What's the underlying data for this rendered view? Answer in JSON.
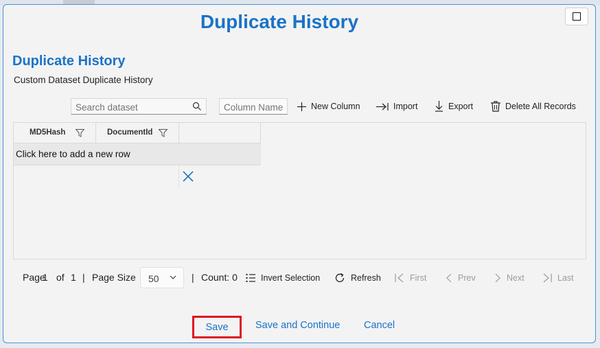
{
  "dialog": {
    "title": "Duplicate History"
  },
  "section": {
    "title": "Duplicate History",
    "subtitle": "Custom Dataset Duplicate History"
  },
  "toolbar": {
    "search_placeholder": "Search dataset",
    "column_name_placeholder": "Column Name",
    "new_column": "New Column",
    "import": "Import",
    "export": "Export",
    "delete_all": "Delete All Records"
  },
  "grid": {
    "columns": [
      "MD5Hash",
      "DocumentId"
    ],
    "add_row_text": "Click here to add a new row"
  },
  "pager": {
    "page_label": "Page",
    "page": "1",
    "of_label": "of",
    "total_pages": "1",
    "sep": "|",
    "page_size_label": "Page Size",
    "page_size": "50",
    "count_text": "Count: 0",
    "invert_selection": "Invert Selection",
    "refresh": "Refresh",
    "first": "First",
    "prev": "Prev",
    "next": "Next",
    "last": "Last"
  },
  "footer": {
    "save": "Save",
    "save_continue": "Save and Continue",
    "cancel": "Cancel"
  },
  "colors": {
    "accent": "#1a73c8",
    "highlight": "#e01020"
  }
}
